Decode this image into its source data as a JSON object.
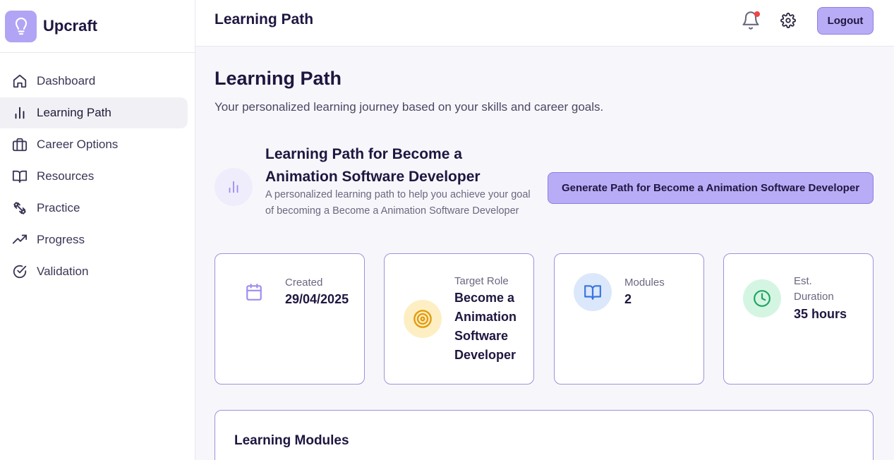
{
  "brand": {
    "name": "Upcraft",
    "logo_icon": "lightbulb-icon",
    "accent": "#b1a4f4"
  },
  "sidebar": {
    "items": [
      {
        "label": "Dashboard",
        "icon": "home-icon",
        "active": false
      },
      {
        "label": "Learning Path",
        "icon": "bar-chart-icon",
        "active": true
      },
      {
        "label": "Career Options",
        "icon": "briefcase-icon",
        "active": false
      },
      {
        "label": "Resources",
        "icon": "book-open-icon",
        "active": false
      },
      {
        "label": "Practice",
        "icon": "dumbbell-icon",
        "active": false
      },
      {
        "label": "Progress",
        "icon": "trending-up-icon",
        "active": false
      },
      {
        "label": "Validation",
        "icon": "check-circle-icon",
        "active": false
      }
    ]
  },
  "header": {
    "title": "Learning Path",
    "logout_label": "Logout",
    "notification_dot_color": "#ef4444"
  },
  "main": {
    "title": "Learning Path",
    "subtitle": "Your personalized learning journey based on your skills and career goals.",
    "path": {
      "title": "Learning Path for Become a Animation Software Developer",
      "description": "A personalized learning path to help you achieve your goal of becoming a Become a Animation Software Developer",
      "generate_label": "Generate Path for Become a Animation Software Developer"
    },
    "stats": [
      {
        "label": "Created",
        "value": "29/04/2025",
        "icon": "calendar-icon"
      },
      {
        "label": "Target Role",
        "value": "Become a Animation Software Developer",
        "icon": "target-icon"
      },
      {
        "label": "Modules",
        "value": "2",
        "icon": "book-open-icon"
      },
      {
        "label": "Est. Duration",
        "value": "35 hours",
        "icon": "clock-icon"
      }
    ],
    "modules_title": "Learning Modules"
  }
}
